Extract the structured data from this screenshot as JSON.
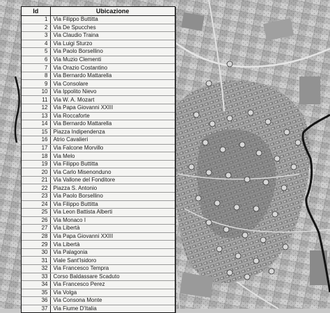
{
  "table": {
    "headers": {
      "id": "Id",
      "location": "Ubicazione"
    },
    "rows": [
      {
        "id": "1",
        "location": "Via Filippo Buttitta"
      },
      {
        "id": "2",
        "location": "Via De Spucches"
      },
      {
        "id": "3",
        "location": "Via Claudio Traina"
      },
      {
        "id": "4",
        "location": "Via Luigi Sturzo"
      },
      {
        "id": "5",
        "location": "Via Paolo Borsellino"
      },
      {
        "id": "6",
        "location": "Via Muzio Clementi"
      },
      {
        "id": "7",
        "location": "Via Orazio Costantino"
      },
      {
        "id": "8",
        "location": "Via Bernardo Mattarella"
      },
      {
        "id": "9",
        "location": "Via Consolare"
      },
      {
        "id": "10",
        "location": "Via Ippolito Nievo"
      },
      {
        "id": "11",
        "location": "Via W. A. Mozart"
      },
      {
        "id": "12",
        "location": "Via Papa Giovanni XXIII"
      },
      {
        "id": "13",
        "location": "Via Roccaforte"
      },
      {
        "id": "14",
        "location": "Via Bernardo Mattarella"
      },
      {
        "id": "15",
        "location": "Piazza Indipendenza"
      },
      {
        "id": "16",
        "location": "Atrio Cavalieri"
      },
      {
        "id": "17",
        "location": "Via Falcone Morvillo"
      },
      {
        "id": "18",
        "location": "Via Melo"
      },
      {
        "id": "19",
        "location": "Via Filippo Buttitta"
      },
      {
        "id": "20",
        "location": "Via Carlo Misenonduno"
      },
      {
        "id": "21",
        "location": "Via Vallone del Fonditore"
      },
      {
        "id": "22",
        "location": "Piazza S. Antonio"
      },
      {
        "id": "23",
        "location": "Via Paolo Borsellino"
      },
      {
        "id": "24",
        "location": "Via Filippo Buttitta"
      },
      {
        "id": "25",
        "location": "Via Leon Battista Alberti"
      },
      {
        "id": "26",
        "location": "Via Monaco I"
      },
      {
        "id": "27",
        "location": "Via Libertà"
      },
      {
        "id": "28",
        "location": "Via Papa Giovanni XXIII"
      },
      {
        "id": "29",
        "location": "Via Libertà"
      },
      {
        "id": "30",
        "location": "Via Palagonia"
      },
      {
        "id": "31",
        "location": "Viale Sant'Isidoro"
      },
      {
        "id": "32",
        "location": "Via Francesco Tempra"
      },
      {
        "id": "33",
        "location": "Corso Baldassare Scaduto"
      },
      {
        "id": "34",
        "location": "Via Francesco Perez"
      },
      {
        "id": "35",
        "location": "Via Volga"
      },
      {
        "id": "36",
        "location": "Via Consona Monte"
      },
      {
        "id": "37",
        "location": "Via Fiume D'Italia"
      }
    ]
  },
  "map": {
    "colors": {
      "base": "#bdbdbd",
      "urban": "#9a9a9a",
      "urban_dark": "#6e6e6e",
      "field_light": "#d6d6d6",
      "field_dark": "#8c8c8c",
      "boundary": "#141414",
      "marker_fill": "#d8d8d8",
      "marker_stroke": "#3a3a3a"
    }
  }
}
